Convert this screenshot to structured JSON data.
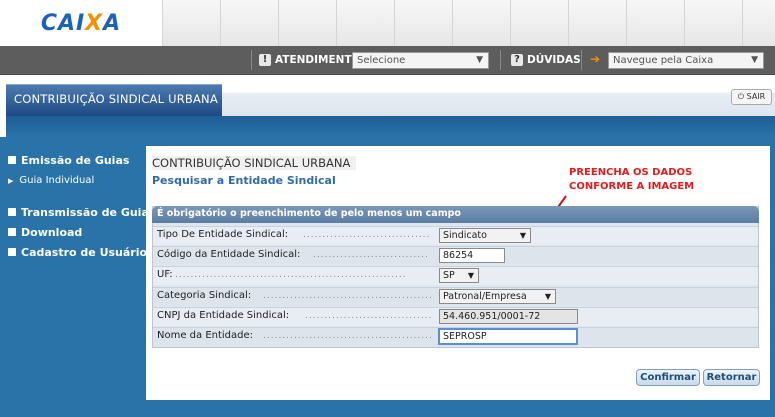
{
  "logo": {
    "text_a": "CAI",
    "text_b": "X",
    "text_c": "A"
  },
  "topbar": {
    "atendimento_label": "ATENDIMENTO",
    "atendimento_select": "Selecione",
    "duvidas_label": "DÚVIDAS",
    "navegue_select": "Navegue pela Caixa",
    "help_icon_glyph": "!",
    "question_icon_glyph": "?",
    "arrow_glyph": "➔"
  },
  "page_title": "CONTRIBUIÇÃO SINDICAL URBANA",
  "exit_label": "SAIR",
  "sidebar": {
    "items": [
      {
        "label": "Emissão de Guias"
      },
      {
        "label": "Guia Individual"
      },
      {
        "label": "Transmissão de Guias"
      },
      {
        "label": "Download"
      },
      {
        "label": "Cadastro de Usuário"
      }
    ]
  },
  "content": {
    "title": "CONTRIBUIÇÃO SINDICAL URBANA",
    "subtitle": "Pesquisar a Entidade Sindical",
    "annotation_line1": "PREENCHA OS DADOS",
    "annotation_line2": "CONFORME A IMAGEM"
  },
  "form": {
    "header": "É obrigatório o preenchimento de pelo menos um campo",
    "fields": [
      {
        "label": "Tipo De Entidade Sindical:",
        "value": "Sindicato"
      },
      {
        "label": "Código da Entidade Sindical:",
        "value": "86254"
      },
      {
        "label": "UF:",
        "value": "SP"
      },
      {
        "label": "Categoria Sindical:",
        "value": "Patronal/Empresa"
      },
      {
        "label": "CNPJ da Entidade Sindical:",
        "value": "54.460.951/0001-72"
      },
      {
        "label": "Nome da Entidade:",
        "value": "SEPROSP"
      }
    ],
    "confirm_label": "Confirmar",
    "return_label": "Retornar"
  },
  "colors": {
    "brand_blue": "#2a73a8",
    "accent_orange": "#f39200",
    "annotation_red": "#e21b1b"
  }
}
